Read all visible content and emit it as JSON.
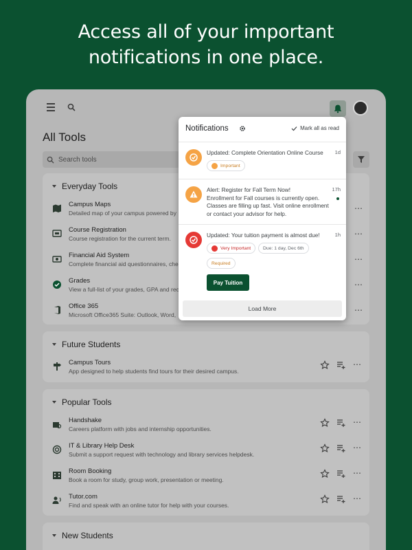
{
  "headline": {
    "line1": "Access all of your important",
    "line2": "notifications in one place."
  },
  "app": {
    "title": "All Tools",
    "search_placeholder": "Search tools",
    "icons": [
      "menu-icon",
      "search-icon",
      "bell-icon",
      "avatar",
      "filter-icon"
    ]
  },
  "sections": [
    {
      "name": "Everyday Tools",
      "tools": [
        {
          "name": "Campus Maps",
          "desc": "Detailed map of your campus powered by",
          "icon": "map-icon"
        },
        {
          "name": "Course Registration",
          "desc": "Course registration for the current term.",
          "icon": "registration-icon"
        },
        {
          "name": "Financial Aid System",
          "desc": "Complete financial aid questionnaires, che",
          "icon": "money-icon"
        },
        {
          "name": "Grades",
          "desc": "View a full-list of your grades, GPA and rec",
          "icon": "verified-icon"
        },
        {
          "name": "Office 365",
          "desc": "Microsoft Office365 Suite: Outlook, Word,",
          "icon": "office-icon"
        }
      ]
    },
    {
      "name": "Future Students",
      "tools": [
        {
          "name": "Campus Tours",
          "desc": "App designed to help students find tours for their desired campus.",
          "icon": "signpost-icon"
        }
      ]
    },
    {
      "name": "Popular Tools",
      "tools": [
        {
          "name": "Handshake",
          "desc": "Careers platform with jobs and internship opportunities.",
          "icon": "job-search-icon"
        },
        {
          "name": "IT & Library Help Desk",
          "desc": "Submit a support request with technology and library services helpdesk.",
          "icon": "support-icon"
        },
        {
          "name": "Room Booking",
          "desc": "Book a room for study, group work, presentation or meeting.",
          "icon": "building-icon"
        },
        {
          "name": "Tutor.com",
          "desc": "Find and speak with an online tutor for help with your courses.",
          "icon": "tutor-icon"
        }
      ]
    },
    {
      "name": "New Students",
      "tools": []
    }
  ],
  "notifications": {
    "title": "Notifications",
    "mark_all": "Mark all as read",
    "load_more": "Load More",
    "items": [
      {
        "title": "Updated: Complete Orientation Online Course",
        "time": "1d",
        "badge_color": "#f5a345",
        "chips": [
          "Important"
        ]
      },
      {
        "title": "Alert: Register for Fall Term Now!",
        "body": "Enrollment for Fall courses is currently open. Classes are filling up fast. Visit online enrollment or contact your advisor for help.",
        "time": "17h",
        "badge_color": "#f5a345",
        "unread": true
      },
      {
        "title": "Updated: Your tuition payment is almost due!",
        "time": "1h",
        "badge_color": "#e53935",
        "chips": [
          "Very Important",
          "Due: 1 day, Dec 6th",
          "Required"
        ],
        "button": "Pay Tuition"
      }
    ]
  },
  "colors": {
    "background": "#0b5130",
    "accent": "#0b5130",
    "important": "#f5a345",
    "very_important": "#e53935"
  }
}
